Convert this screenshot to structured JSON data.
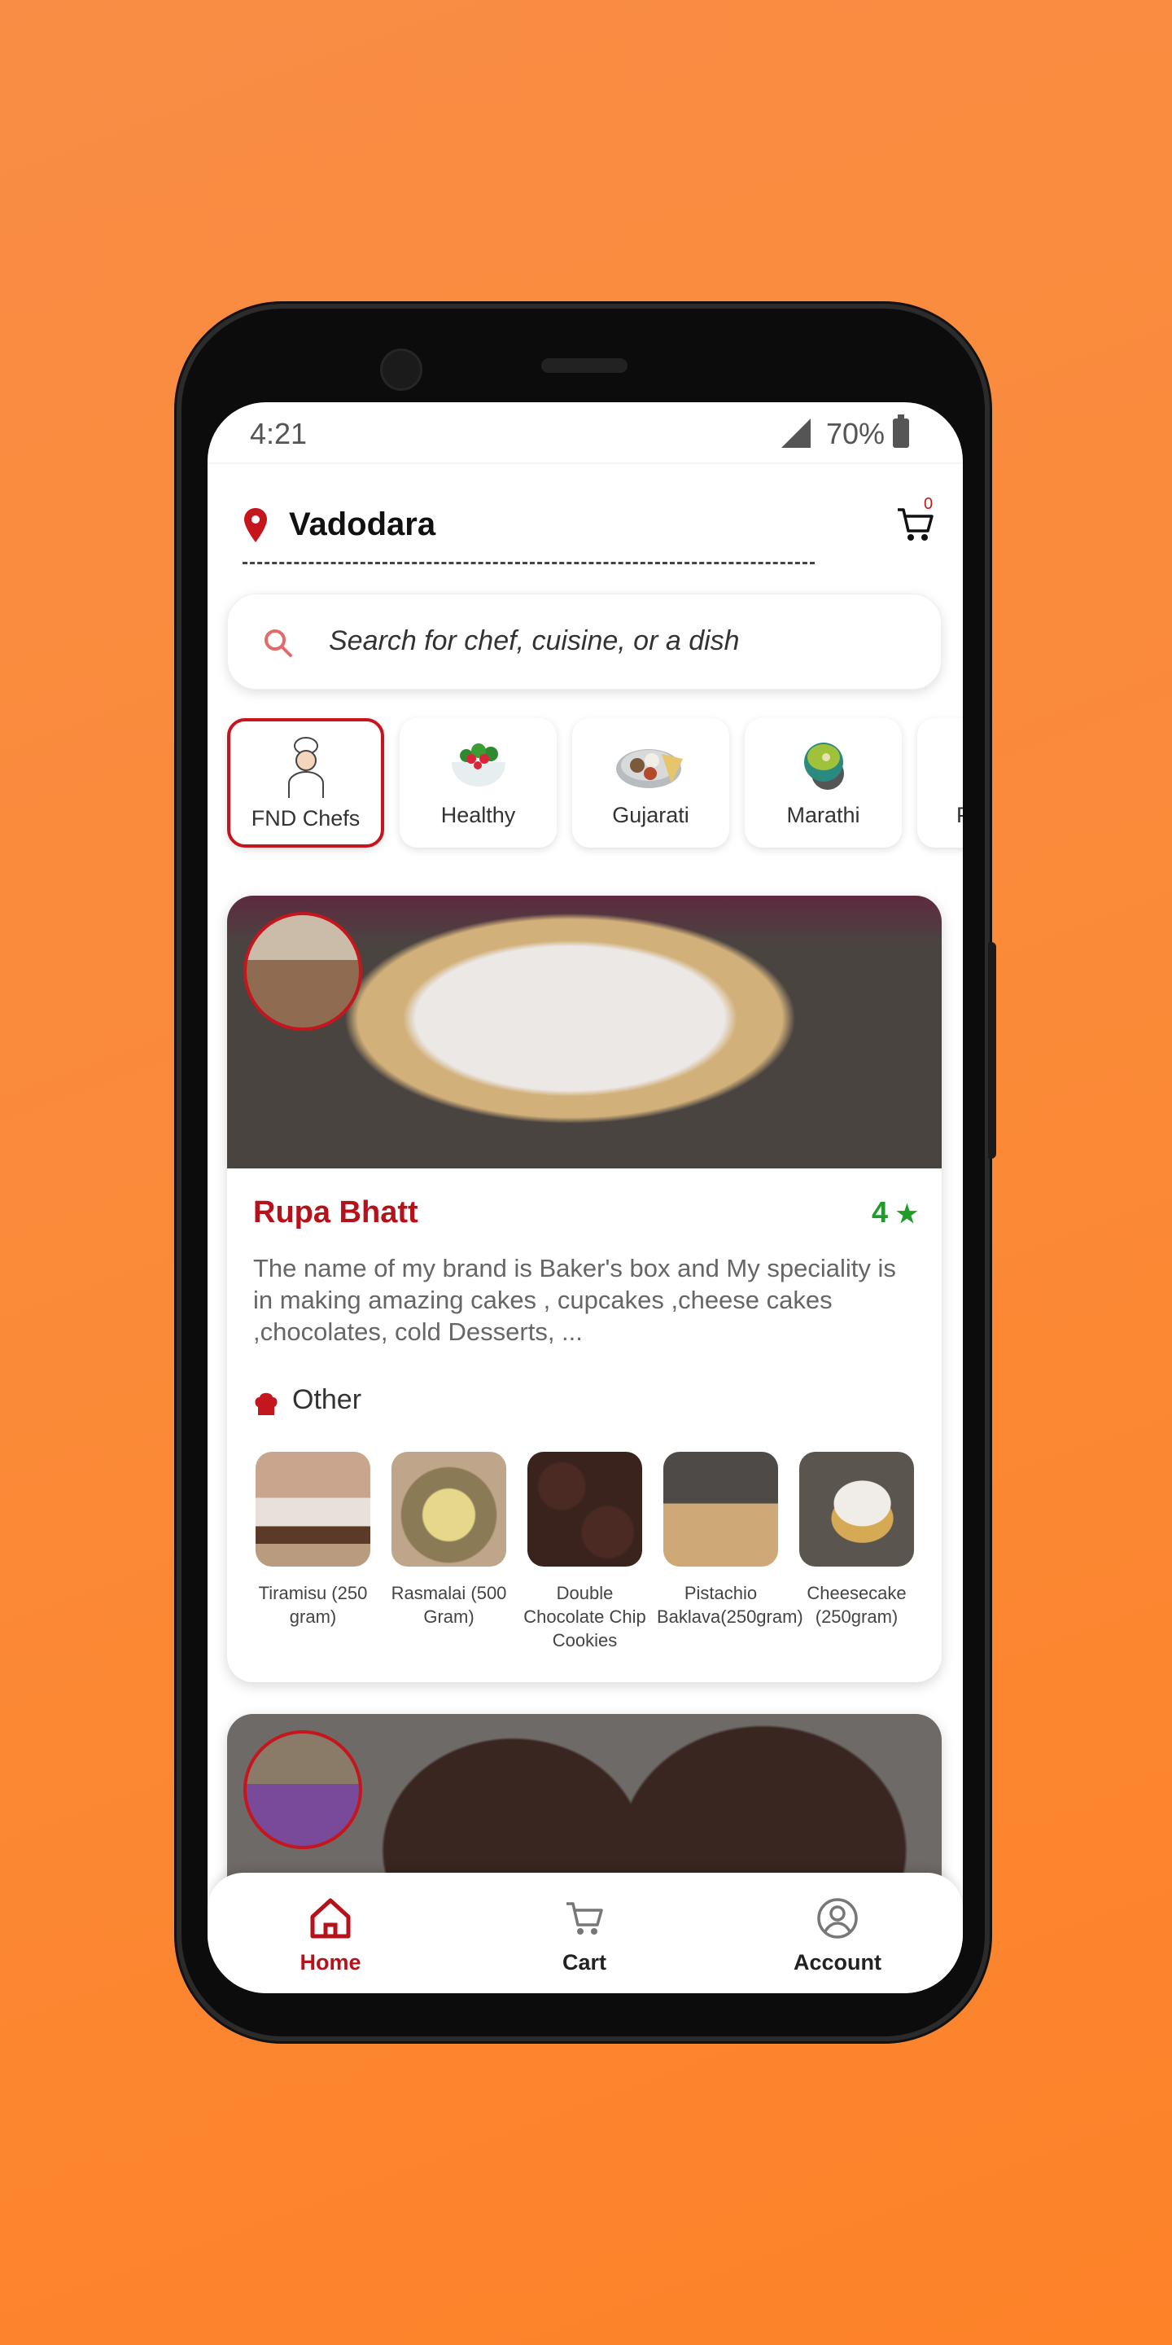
{
  "status_bar": {
    "time": "4:21",
    "battery": "70%"
  },
  "header": {
    "city": "Vadodara",
    "cart_count": "0"
  },
  "search": {
    "placeholder": "Search for chef, cuisine, or a dish"
  },
  "categories": [
    {
      "label": "FND Chefs",
      "selected": true
    },
    {
      "label": "Healthy"
    },
    {
      "label": "Gujarati"
    },
    {
      "label": "Marathi"
    },
    {
      "label": "P"
    }
  ],
  "chefs": [
    {
      "name": "Rupa Bhatt",
      "rating": "4",
      "rating_icon": "star-icon",
      "description": "The name of my brand  is Baker's box and My speciality is in making amazing cakes , cupcakes ,cheese cakes ,chocolates, cold Desserts, ...",
      "cuisine": "Other",
      "dishes": [
        {
          "name": "Tiramisu (250 gram)"
        },
        {
          "name": "Rasmalai (500 Gram)"
        },
        {
          "name": "Double Chocolate Chip Cookies"
        },
        {
          "name": "Pistachio Baklava(250gram)"
        },
        {
          "name": "Cheesecake (250gram)"
        }
      ]
    }
  ],
  "bottom_nav": [
    {
      "label": "Home",
      "icon": "home-icon",
      "active": true
    },
    {
      "label": "Cart",
      "icon": "cart-icon"
    },
    {
      "label": "Account",
      "icon": "account-icon"
    }
  ],
  "colors": {
    "accent": "#b5121b",
    "rating": "#1f9c2a",
    "background": "#fb8a38"
  }
}
